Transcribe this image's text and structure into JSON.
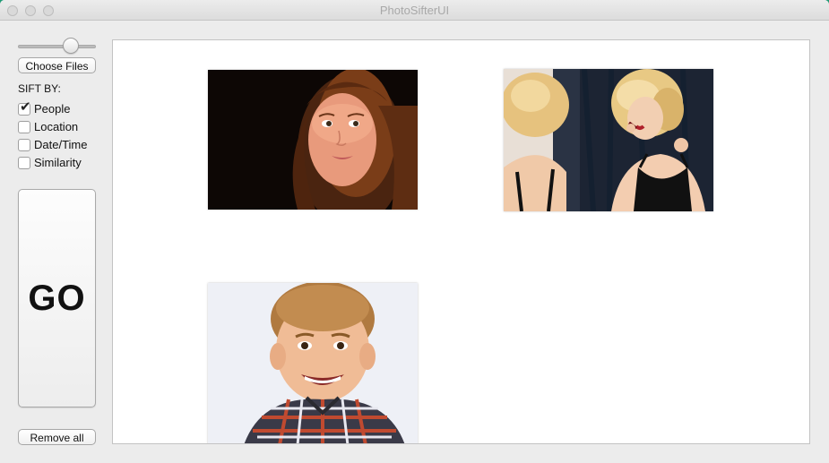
{
  "window": {
    "title": "PhotoSifterUI"
  },
  "sidebar": {
    "slider": {
      "value": 0.68
    },
    "choose_files_label": "Choose Files",
    "sift_by_label": "SIFT BY:",
    "options": [
      {
        "label": "People",
        "checked": true
      },
      {
        "label": "Location",
        "checked": false
      },
      {
        "label": "Date/Time",
        "checked": false
      },
      {
        "label": "Similarity",
        "checked": false
      }
    ],
    "go_label": "GO",
    "remove_all_label": "Remove all"
  },
  "photos": [
    {
      "subject": "girl-with-long-hair"
    },
    {
      "subject": "woman-at-mirror-with-lipstick"
    },
    {
      "subject": "smiling-boy-in-plaid-shirt"
    }
  ],
  "colors": {
    "desktop": "#1e9a74",
    "window_bg": "#ececec",
    "content_bg": "#ffffff"
  }
}
